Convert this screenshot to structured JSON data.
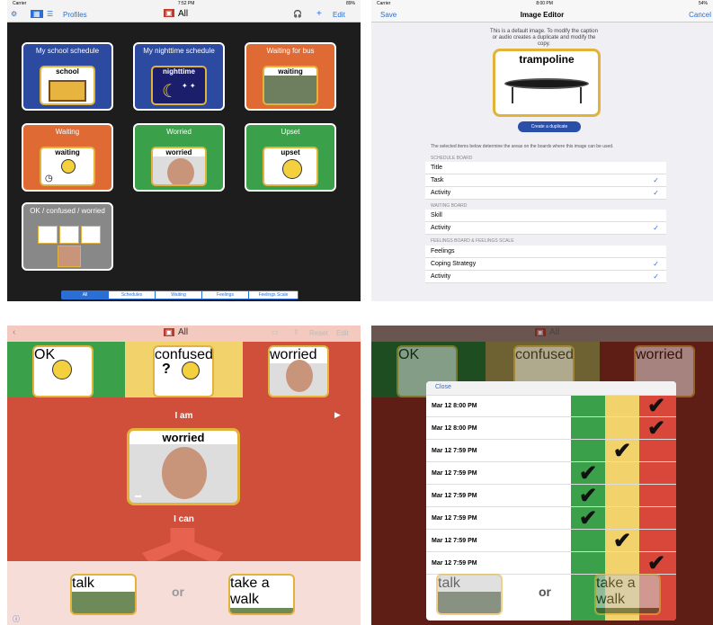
{
  "p1": {
    "carrier": "Carrier",
    "time": "7:52 PM",
    "battery": "89%",
    "profiles": "Profiles",
    "title": "All",
    "edit": "Edit",
    "tiles": [
      {
        "title": "My school schedule",
        "cap": "school"
      },
      {
        "title": "My nighttime schedule",
        "cap": "nighttime"
      },
      {
        "title": "Waiting for bus",
        "cap": "waiting"
      },
      {
        "title": "Waiting",
        "cap": "waiting"
      },
      {
        "title": "Worried",
        "cap": "worried"
      },
      {
        "title": "Upset",
        "cap": "upset"
      },
      {
        "title": "OK / confused / worried",
        "cap": ""
      }
    ],
    "segments": [
      "All",
      "Schedules",
      "Waiting",
      "Feelings",
      "Feelings Scale"
    ]
  },
  "p2": {
    "carrier": "Carrier",
    "time": "8:00 PM",
    "battery": "54%",
    "save": "Save",
    "title": "Image Editor",
    "cancel": "Cancel",
    "note": "This is a default image. To modify the caption or audio creates a duplicate and modify the copy.",
    "image_caption": "trampoline",
    "dup": "Create a duplicate",
    "desc": "The selected items below determine the areas on the boards where this image can be used.",
    "s1": "SCHEDULE BOARD",
    "s1rows": [
      "Title",
      "Task",
      "Activity"
    ],
    "s2": "WAITING BOARD",
    "s2rows": [
      "Skill",
      "Activity"
    ],
    "s3": "FEELINGS BOARD & FEELINGS SCALE",
    "s3rows": [
      "Feelings",
      "Coping Strategy",
      "Activity"
    ]
  },
  "p3": {
    "title": "All",
    "reset": "Reset",
    "edit": "Edit",
    "ok": "OK",
    "confused": "confused",
    "worried": "worried",
    "iam": "I am",
    "big": "worried",
    "ican": "I can",
    "talk": "talk",
    "or": "or",
    "walk": "take a walk"
  },
  "p4": {
    "title": "All",
    "close": "Close",
    "rows": [
      "Mar 12 8:00 PM",
      "Mar 12 8:00 PM",
      "Mar 12 7:59 PM",
      "Mar 12 7:59 PM",
      "Mar 12 7:59 PM",
      "Mar 12 7:59 PM",
      "Mar 12 7:59 PM",
      "Mar 12 7:59 PM"
    ],
    "checks": [
      2,
      2,
      1,
      0,
      0,
      0,
      1,
      2
    ],
    "talk": "talk",
    "or": "or",
    "walk": "take a walk",
    "ok": "OK",
    "confused": "confused",
    "worried": "worried"
  },
  "colors": {
    "green": "#3aa04a",
    "yellow": "#f2d36b",
    "red": "#d9473a",
    "blue": "#2a6fd6"
  }
}
